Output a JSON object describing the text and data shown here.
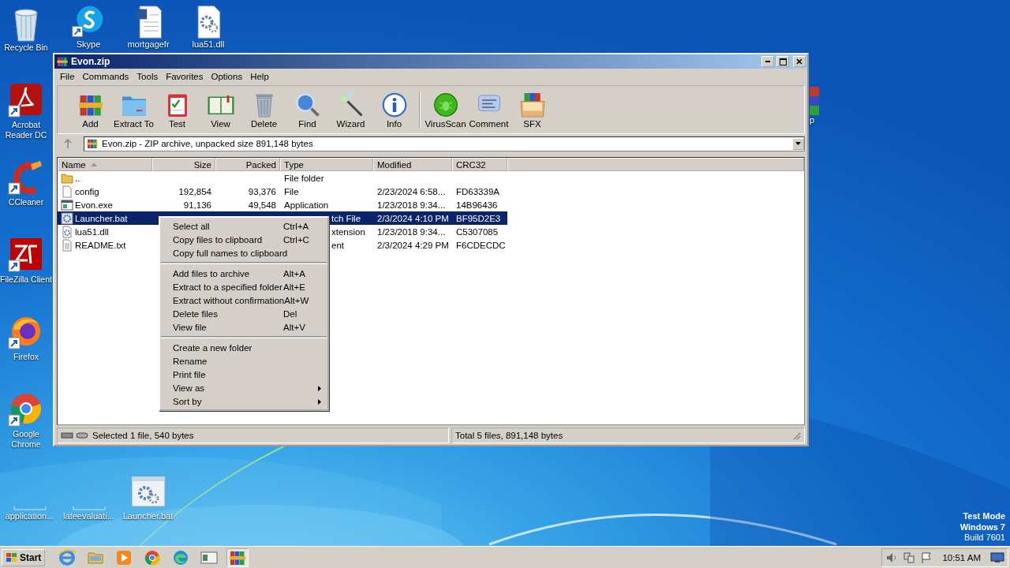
{
  "desktop": {
    "icons_left": [
      {
        "label": "Recycle Bin",
        "kind": "recycle",
        "shortcut": false
      },
      {
        "label": "Acrobat Reader DC",
        "kind": "acrobat",
        "shortcut": true
      },
      {
        "label": "CCleaner",
        "kind": "ccleaner",
        "shortcut": true
      },
      {
        "label": "FileZilla Client",
        "kind": "filezilla",
        "shortcut": true
      },
      {
        "label": "Firefox",
        "kind": "firefox",
        "shortcut": true
      },
      {
        "label": "Google Chrome",
        "kind": "chrome",
        "shortcut": true
      }
    ],
    "icons_top": [
      {
        "label": "Skype",
        "kind": "skype",
        "shortcut": true
      },
      {
        "label": "mortgagefr",
        "kind": "worddoc",
        "shortcut": false
      },
      {
        "label": "lua51.dll",
        "kind": "dll",
        "shortcut": false
      }
    ],
    "icons_bottom": [
      {
        "label": "application...",
        "kind": "blank",
        "shortcut": false
      },
      {
        "label": "lateevaluati...",
        "kind": "blank",
        "shortcut": false
      },
      {
        "label": "Launcher.bat",
        "kind": "bat",
        "shortcut": false
      }
    ],
    "icons_right": [
      {
        "label": "p",
        "kind": "rar",
        "shortcut": false
      }
    ],
    "system_notice": [
      "Test Mode",
      "Windows 7",
      "Build 7601"
    ]
  },
  "window": {
    "title": "Evon.zip",
    "menu": [
      "File",
      "Commands",
      "Tools",
      "Favorites",
      "Options",
      "Help"
    ],
    "toolbar": [
      {
        "label": "Add",
        "kind": "add"
      },
      {
        "label": "Extract To",
        "kind": "extract"
      },
      {
        "label": "Test",
        "kind": "test"
      },
      {
        "label": "View",
        "kind": "view"
      },
      {
        "label": "Delete",
        "kind": "delete"
      },
      {
        "label": "Find",
        "kind": "find"
      },
      {
        "label": "Wizard",
        "kind": "wizard"
      },
      {
        "label": "Info",
        "kind": "info"
      },
      {
        "kind": "separator"
      },
      {
        "label": "VirusScan",
        "kind": "virus"
      },
      {
        "label": "Comment",
        "kind": "comment"
      },
      {
        "label": "SFX",
        "kind": "sfx"
      }
    ],
    "address": "Evon.zip - ZIP archive, unpacked size 891,148 bytes",
    "columns": [
      {
        "label": "Name",
        "sorted": true
      },
      {
        "label": "Size",
        "sorted": false
      },
      {
        "label": "Packed",
        "sorted": false
      },
      {
        "label": "Type",
        "sorted": false
      },
      {
        "label": "Modified",
        "sorted": false
      },
      {
        "label": "CRC32",
        "sorted": false
      }
    ],
    "rows": [
      {
        "name": "..",
        "kind": "folder",
        "size": "",
        "packed": "",
        "type": "File folder",
        "modified": "",
        "crc": "",
        "selected": false,
        "type_partly_hidden": false
      },
      {
        "name": "config",
        "kind": "file",
        "size": "192,854",
        "packed": "93,376",
        "type": "File",
        "modified": "2/23/2024 6:58...",
        "crc": "FD63339A",
        "selected": false,
        "type_partly_hidden": false
      },
      {
        "name": "Evon.exe",
        "kind": "exe",
        "size": "91,136",
        "packed": "49,548",
        "type": "Application",
        "modified": "1/23/2018 9:34...",
        "crc": "14B96436",
        "selected": false,
        "type_partly_hidden": false
      },
      {
        "name": "Launcher.bat",
        "kind": "bat",
        "type": "tch File",
        "modified": "2/3/2024 4:10 PM",
        "crc": "BF95D2E3",
        "selected": true,
        "type_partly_hidden": true
      },
      {
        "name": "lua51.dll",
        "kind": "dll",
        "type": "xtension",
        "modified": "1/23/2018 9:34...",
        "crc": "C5307085",
        "selected": false,
        "type_partly_hidden": true
      },
      {
        "name": "README.txt",
        "kind": "txt",
        "type": "ent",
        "modified": "2/3/2024 4:29 PM",
        "crc": "F6CDECDC",
        "selected": false,
        "type_partly_hidden": true
      }
    ],
    "status": [
      "Selected 1 file, 540 bytes",
      "Total 5 files, 891,148 bytes"
    ]
  },
  "context_menu": [
    {
      "kind": "item",
      "label": "Select all",
      "shortcut": "Ctrl+A",
      "submenu": false
    },
    {
      "kind": "item",
      "label": "Copy files to clipboard",
      "shortcut": "Ctrl+C",
      "submenu": false
    },
    {
      "kind": "item",
      "label": "Copy full names to clipboard",
      "submenu": false
    },
    {
      "kind": "separator"
    },
    {
      "kind": "item",
      "label": "Add files to archive",
      "shortcut": "Alt+A",
      "submenu": false
    },
    {
      "kind": "item",
      "label": "Extract to a specified folder",
      "shortcut": "Alt+E",
      "submenu": false
    },
    {
      "kind": "item",
      "label": "Extract without confirmation",
      "shortcut": "Alt+W",
      "submenu": false
    },
    {
      "kind": "item",
      "label": "Delete files",
      "shortcut": "Del",
      "submenu": false
    },
    {
      "kind": "item",
      "label": "View file",
      "shortcut": "Alt+V",
      "submenu": false
    },
    {
      "kind": "separator"
    },
    {
      "kind": "item",
      "label": "Create a new folder",
      "submenu": false
    },
    {
      "kind": "item",
      "label": "Rename",
      "submenu": false
    },
    {
      "kind": "item",
      "label": "Print file",
      "submenu": false
    },
    {
      "kind": "item",
      "label": "View as",
      "submenu": true
    },
    {
      "kind": "item",
      "label": "Sort by",
      "submenu": true
    }
  ],
  "taskbar": {
    "start": "Start",
    "apps": [
      {
        "kind": "ie",
        "active": false
      },
      {
        "kind": "explorer",
        "active": false
      },
      {
        "kind": "media",
        "active": false
      },
      {
        "kind": "chrome",
        "active": false
      },
      {
        "kind": "edge",
        "active": false
      },
      {
        "kind": "window",
        "active": false
      },
      {
        "kind": "rar",
        "active": true
      }
    ],
    "clock": "10:51 AM"
  }
}
